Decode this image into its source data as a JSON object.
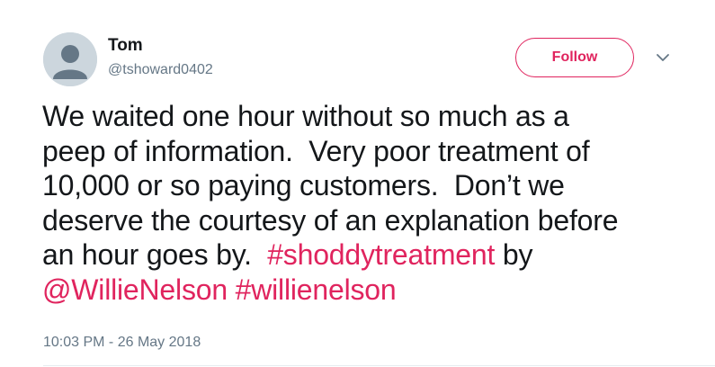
{
  "author": {
    "display_name": "Tom",
    "handle": "@tshoward0402"
  },
  "follow_button": {
    "label": "Follow"
  },
  "tweet": {
    "line1": "We waited one hour without so much as a",
    "line2": "peep of information.  Very poor treatment of",
    "line3": "10,000 or so paying customers.  Don’t we",
    "line4": "deserve the courtesy of an explanation before",
    "line5_text": "an hour goes by.  ",
    "hashtag_shoddy": "#shoddytreatment",
    "line5_by": " by",
    "mention": "@WillieNelson",
    "hashtag_willie": "#willienelson",
    "timestamp": "10:03 PM - 26 May 2018"
  },
  "icons": {
    "avatar": "default-avatar-icon",
    "caret": "chevron-down-icon"
  },
  "colors": {
    "accent": "#e0245e",
    "text": "#14171a",
    "secondary": "#657786",
    "avatar_bg": "#ccd6dd"
  }
}
